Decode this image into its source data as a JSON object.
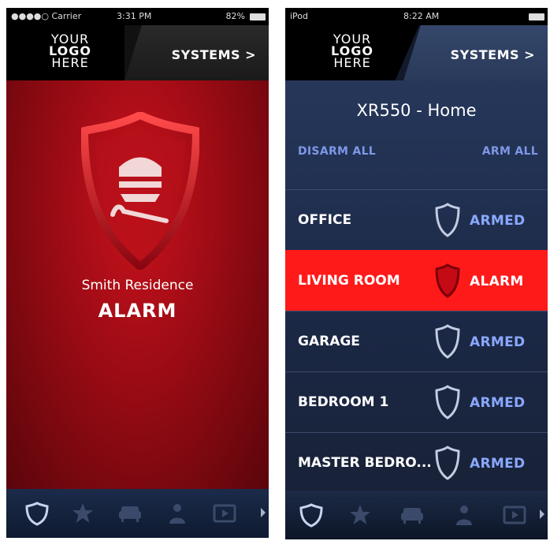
{
  "left_screen": {
    "status_bar": {
      "carrier": "●●●●○ Carrier",
      "time": "3:31 PM",
      "battery": "82%"
    },
    "logo": {
      "line1": "YOUR",
      "line2": "LOGO",
      "line3": "HERE"
    },
    "systems_label": "SYSTEMS >",
    "residence_name": "Smith Residence",
    "status": "ALARM",
    "colors": {
      "background": "#9a0b14",
      "accent": "#e0101c"
    }
  },
  "right_screen": {
    "status_bar": {
      "device": "iPod",
      "time": "8:22 AM"
    },
    "logo": {
      "line1": "YOUR",
      "line2": "LOGO",
      "line3": "HERE"
    },
    "systems_label": "SYSTEMS >",
    "system_name": "XR550 - Home",
    "disarm_all_label": "DISARM ALL",
    "arm_all_label": "ARM ALL",
    "zones": [
      {
        "name": "OFFICE",
        "status": "ARMED"
      },
      {
        "name": "LIVING ROOM",
        "status": "ALARM"
      },
      {
        "name": "GARAGE",
        "status": "ARMED"
      },
      {
        "name": "BEDROOM 1",
        "status": "ARMED"
      },
      {
        "name": "MASTER BEDRO...",
        "status": "ARMED"
      }
    ],
    "colors": {
      "background": "#1f2f4d",
      "alarm_row": "#ff1a1a",
      "armed_text": "#8aa8ff",
      "link": "#7e97e8"
    }
  },
  "tab_bar": {
    "icons": [
      "shield-icon",
      "star-icon",
      "sofa-icon",
      "person-icon",
      "play-icon"
    ]
  }
}
